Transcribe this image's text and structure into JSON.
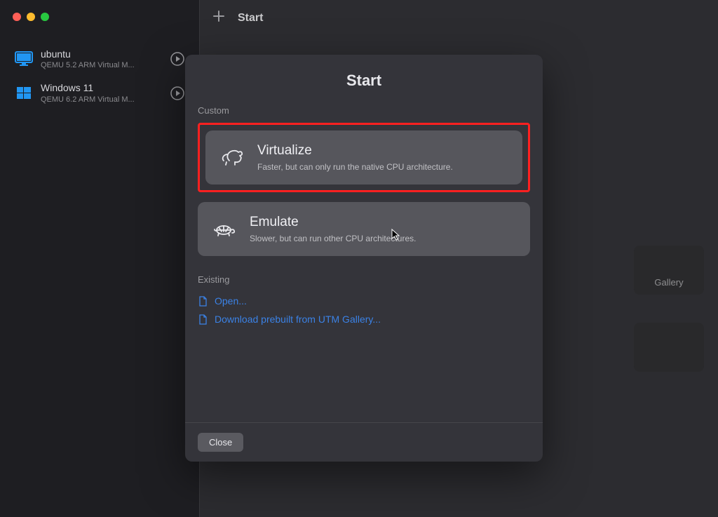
{
  "sidebar": {
    "vms": [
      {
        "name": "ubuntu",
        "subtitle": "QEMU 5.2 ARM Virtual M...",
        "icon": "monitor",
        "icon_color": "#2196f3"
      },
      {
        "name": "Windows 11",
        "subtitle": "QEMU 6.2 ARM Virtual M...",
        "icon": "windows",
        "icon_color": "#2196f3"
      }
    ]
  },
  "toolbar": {
    "title": "Start"
  },
  "background": {
    "gallery_label": "Gallery"
  },
  "modal": {
    "title": "Start",
    "custom_label": "Custom",
    "options": [
      {
        "title": "Virtualize",
        "description": "Faster, but can only run the native CPU architecture.",
        "icon": "rabbit"
      },
      {
        "title": "Emulate",
        "description": "Slower, but can run other CPU architectures.",
        "icon": "turtle"
      }
    ],
    "existing_label": "Existing",
    "links": [
      {
        "text": "Open..."
      },
      {
        "text": "Download prebuilt from UTM Gallery..."
      }
    ],
    "close_label": "Close"
  }
}
